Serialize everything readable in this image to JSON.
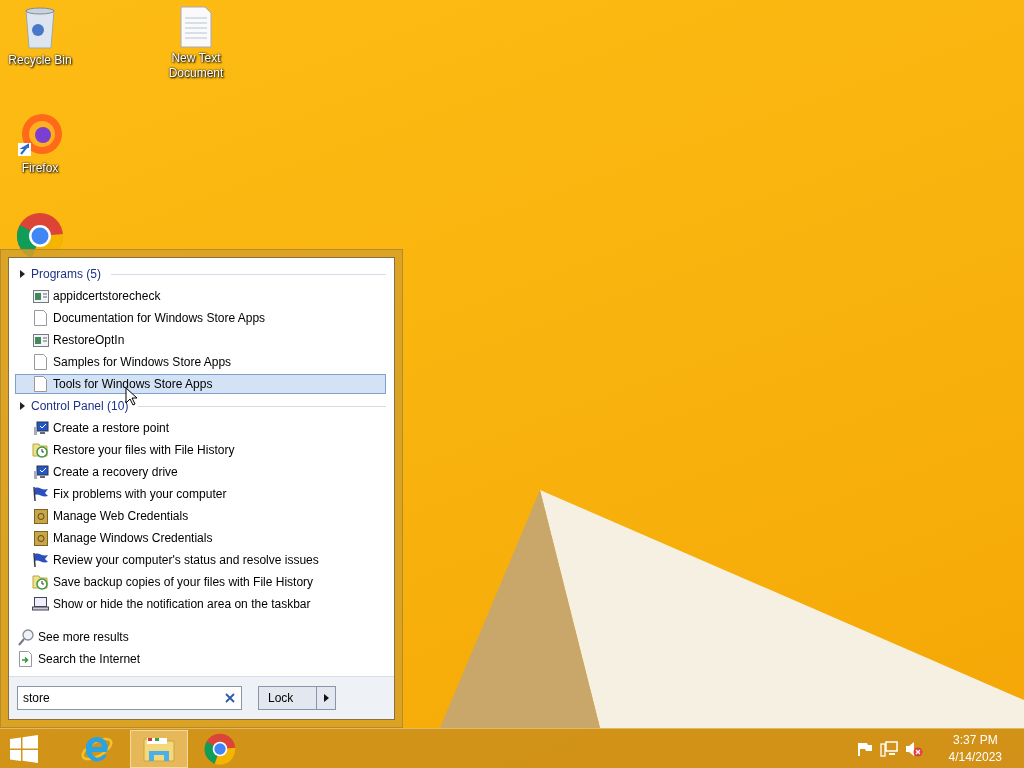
{
  "desktop": {
    "icons": [
      {
        "kind": "recycle-bin",
        "label": "Recycle Bin"
      },
      {
        "kind": "text-document",
        "label": "New Text Document"
      },
      {
        "kind": "firefox",
        "label": "Firefox"
      },
      {
        "kind": "chrome"
      }
    ]
  },
  "start_menu": {
    "groups": [
      {
        "title": "Programs (5)",
        "items": [
          {
            "label": "appidcertstorecheck",
            "kind": "app",
            "selected": false
          },
          {
            "label": "Documentation for Windows Store Apps",
            "kind": "document",
            "selected": false
          },
          {
            "label": "RestoreOptIn",
            "kind": "app",
            "selected": false
          },
          {
            "label": "Samples for Windows Store Apps",
            "kind": "document",
            "selected": false
          },
          {
            "label": "Tools for Windows Store Apps",
            "kind": "document",
            "selected": true
          }
        ]
      },
      {
        "title": "Control Panel (10)",
        "items": [
          {
            "label": "Create a restore point",
            "kind": "system",
            "selected": false
          },
          {
            "label": "Restore your files with File History",
            "kind": "history",
            "selected": false
          },
          {
            "label": "Create a recovery drive",
            "kind": "system",
            "selected": false
          },
          {
            "label": "Fix problems with your computer",
            "kind": "troubleshoot",
            "selected": false
          },
          {
            "label": "Manage Web Credentials",
            "kind": "credentials",
            "selected": false
          },
          {
            "label": "Manage Windows Credentials",
            "kind": "credentials",
            "selected": false
          },
          {
            "label": "Review your computer's status and resolve issues",
            "kind": "troubleshoot",
            "selected": false
          },
          {
            "label": "Save backup copies of your files with File History",
            "kind": "history",
            "selected": false
          },
          {
            "label": "Show or hide the notification area on the taskbar",
            "kind": "taskbar",
            "selected": false
          }
        ]
      }
    ],
    "links": [
      {
        "label": "See more results",
        "kind": "more"
      },
      {
        "label": "Search the Internet",
        "kind": "web"
      }
    ],
    "search": {
      "value": "store"
    },
    "power_button": {
      "label": "Lock"
    }
  },
  "taskbar": {
    "buttons": [
      {
        "kind": "start",
        "active": false
      },
      {
        "kind": "internet-explorer",
        "active": false
      },
      {
        "kind": "file-explorer",
        "active": true
      },
      {
        "kind": "chrome",
        "active": false
      }
    ],
    "tray": [
      {
        "kind": "flag"
      },
      {
        "kind": "network"
      },
      {
        "kind": "volume-muted"
      }
    ],
    "clock": {
      "time": "3:37 PM",
      "date": "4/14/2023"
    }
  }
}
